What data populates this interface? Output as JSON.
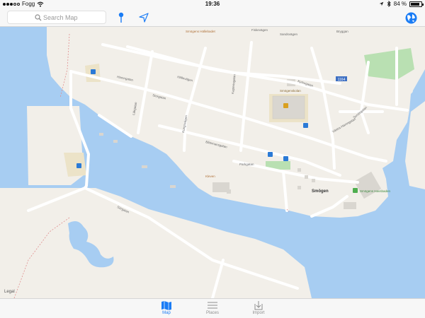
{
  "status_bar": {
    "carrier": "Fogg",
    "time": "19:36",
    "battery_percent": "84 %",
    "battery_level": 0.84
  },
  "toolbar": {
    "search_placeholder": "Search Map",
    "pin_icon": "pin-icon",
    "location_icon": "location-arrow-icon",
    "globe_icon": "globe-icon"
  },
  "map": {
    "legal": "Legal",
    "town_label": "Smögen",
    "place_labels": {
      "hallebadet": "Smögens Hällebadet",
      "skola": "Smögenskolan",
      "havsbaden": "Smögens Havsbaden",
      "road_number": "1164",
      "kleven": "Kleven"
    },
    "streets": {
      "hamngatan": "Hamngatan",
      "storgatan": "Storgatan",
      "lakgatan": "Läkgatan",
      "kungsvagen": "Kungsvägen",
      "kaptensgatan": "Kaptensgatan",
      "fiskevagen": "Fiskevägen",
      "bryggan": "Bryggan",
      "sandsvagen": "Sandsvägen",
      "hallevagen": "Hällevägen",
      "batsmansgatan": "Båtsmansgatan",
      "kyrkogatan": "Kyrkogatan",
      "vastra": "Västra Hamngatan",
      "parkgatan": "Parkgatan",
      "sundsgatan": "Sundsgatan",
      "sorgatan": "Sörgatan"
    },
    "colors": {
      "water": "#a7cdf2",
      "land": "#f2efe9",
      "road": "#ffffff",
      "park": "#b9e0b2",
      "sand": "#ece3c8",
      "building": "#d9d6d0"
    }
  },
  "tabs": [
    {
      "label": "Map",
      "icon": "map-icon",
      "active": true
    },
    {
      "label": "Places",
      "icon": "list-icon",
      "active": false
    },
    {
      "label": "Import",
      "icon": "import-icon",
      "active": false
    }
  ]
}
